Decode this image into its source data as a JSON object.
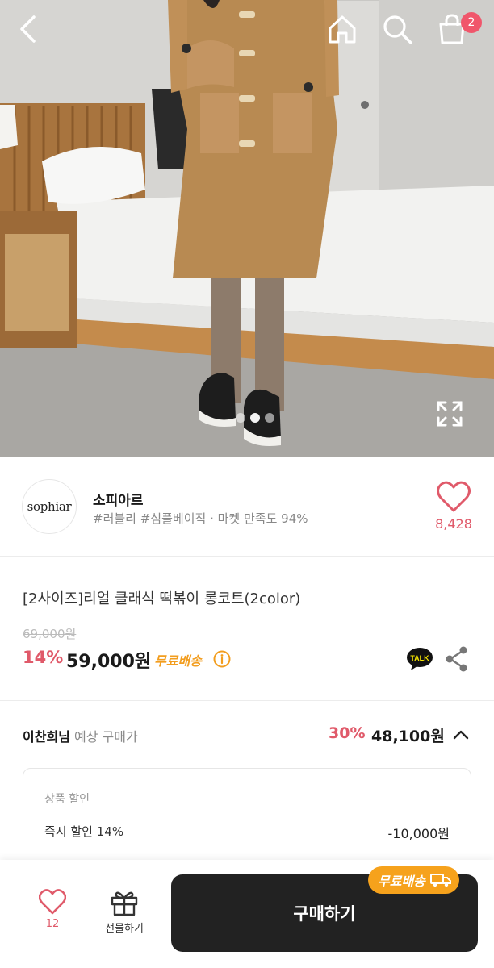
{
  "header": {
    "back_icon": "chevron-left-icon",
    "home_icon": "home-icon",
    "search_icon": "search-icon",
    "cart_icon": "shopping-bag-icon",
    "cart_count": "2",
    "expand_icon": "expand-icon",
    "image_pages": 3,
    "image_active_index": 1
  },
  "seller": {
    "logo_text": "sophiar",
    "name": "소피아르",
    "tags": "#러블리 #심플베이직 · 마켓 만족도 94%",
    "like_count": "8,428"
  },
  "product": {
    "title": "[2사이즈]리얼 클래식 떡볶이 롱코트(2color)",
    "original_price": "69,000원",
    "discount_rate": "14%",
    "price": "59,000원",
    "free_shipping": "무료배송",
    "kakao_label": "TALK"
  },
  "expected": {
    "user": "이찬희님",
    "label": " 예상 구매가",
    "discount_rate": "30%",
    "price": "48,100원"
  },
  "breakdown": {
    "header": "상품 할인",
    "rows": [
      {
        "label": "즉시 할인 14%",
        "value": "-10,000원"
      }
    ]
  },
  "bottom_bar": {
    "like_count": "12",
    "gift_label": "선물하기",
    "buy_label": "구매하기",
    "badge_label": "무료배송"
  },
  "colors": {
    "accent_pink": "#e05a6a",
    "free_ship_orange": "#f29d1e",
    "buy_button": "#222222",
    "badge_red": "#f0566b"
  }
}
